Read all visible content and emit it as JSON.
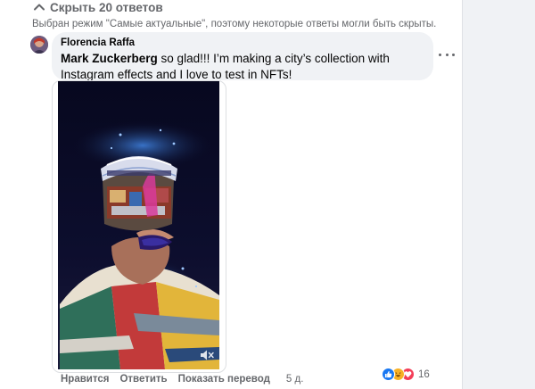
{
  "thread": {
    "collapse_label": "Скрыть 20 ответов",
    "notice": "Выбран режим \"Самые актуальные\", поэтому некоторые ответы могли быть скрыты."
  },
  "comment": {
    "author": "Florencia Raffa",
    "mention": "Mark Zuckerberg",
    "text": " so glad!!! I’m making a city’s collection with Instagram effects and I love to test in NFTs!"
  },
  "actions": {
    "like": "Нравится",
    "reply": "Ответить",
    "translate": "Показать перевод",
    "time": "5 д."
  },
  "reactions": {
    "count": "16",
    "types": [
      "like",
      "haha",
      "love"
    ]
  },
  "colors": {
    "accent": "#1877f2",
    "secondary_text": "#65676b",
    "bubble_bg": "#f0f2f5"
  }
}
